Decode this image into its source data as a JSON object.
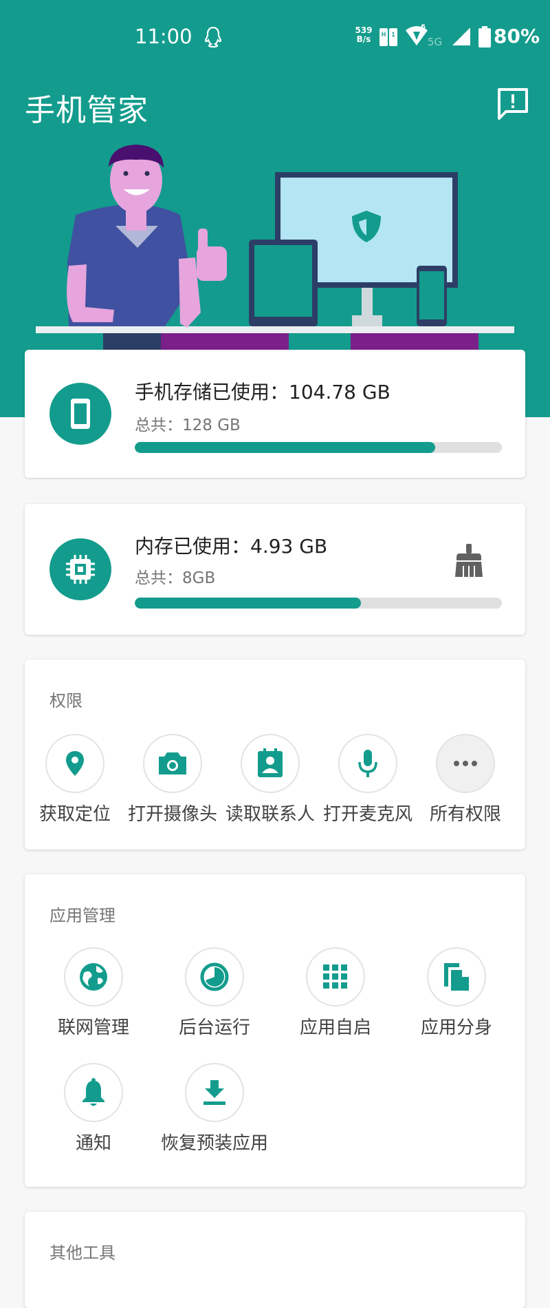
{
  "status_bar": {
    "time": "11:00",
    "net_speed_value": "539",
    "net_speed_unit": "B/s",
    "wifi_generation": "6",
    "network_type": "5G",
    "battery": "80%"
  },
  "header": {
    "title": "手机管家"
  },
  "storage": {
    "title": "手机存储已使用：104.78 GB",
    "total": "总共：128 GB",
    "used_fraction": 0.8186
  },
  "memory": {
    "title": "内存已使用：4.93 GB",
    "total": "总共：8GB",
    "used_fraction": 0.616
  },
  "permissions": {
    "title": "权限",
    "items": [
      {
        "label": "获取定位",
        "icon": "location-icon"
      },
      {
        "label": "打开摄像头",
        "icon": "camera-icon"
      },
      {
        "label": "读取联系人",
        "icon": "contacts-icon"
      },
      {
        "label": "打开麦克风",
        "icon": "microphone-icon"
      },
      {
        "label": "所有权限",
        "icon": "more-icon"
      }
    ]
  },
  "app_management": {
    "title": "应用管理",
    "items": [
      {
        "label": "联网管理",
        "icon": "globe-icon"
      },
      {
        "label": "后台运行",
        "icon": "pie-icon"
      },
      {
        "label": "应用自启",
        "icon": "grid-icon"
      },
      {
        "label": "应用分身",
        "icon": "clone-icon"
      },
      {
        "label": "通知",
        "icon": "bell-icon"
      },
      {
        "label": "恢复预装应用",
        "icon": "download-icon"
      }
    ]
  },
  "other_tools": {
    "title": "其他工具"
  },
  "colors": {
    "accent": "#139c8d",
    "track": "#e0e0e0"
  }
}
